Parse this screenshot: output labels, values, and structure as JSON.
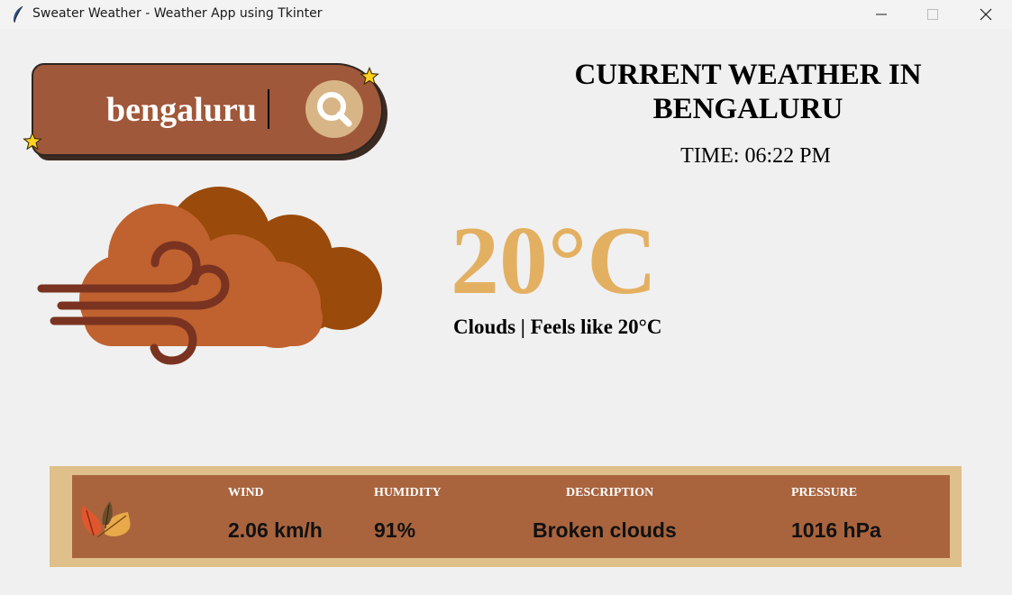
{
  "window": {
    "title": "Sweater Weather - Weather App using Tkinter",
    "app_icon": "feather-icon",
    "controls": [
      "minimize-icon",
      "maximize-icon",
      "close-icon"
    ]
  },
  "search": {
    "value": "bengaluru",
    "button_icon": "search-icon"
  },
  "header": {
    "title": "CURRENT WEATHER IN BENGALURU",
    "time": "TIME: 06:22 PM"
  },
  "current": {
    "icon": "wind-clouds-icon",
    "temperature": "20°C",
    "condition": "Clouds | Feels like 20°C"
  },
  "stats": {
    "decoration_icon": "autumn-leaves-icon",
    "wind": {
      "label": "WIND",
      "value": "2.06 km/h"
    },
    "humidity": {
      "label": "HUMIDITY",
      "value": "91%"
    },
    "description": {
      "label": "DESCRIPTION",
      "value": "Broken clouds"
    },
    "pressure": {
      "label": "PRESSURE",
      "value": "1016 hPa"
    }
  },
  "colors": {
    "search_box": "#a0583a",
    "search_button": "#d8b586",
    "temperature": "#e3b062",
    "panel_outer": "#dfc08b",
    "panel_inner": "#a9643e",
    "cloud_dark": "#9a4a0a",
    "cloud_light": "#c0622f",
    "wind": "#7a3320"
  }
}
